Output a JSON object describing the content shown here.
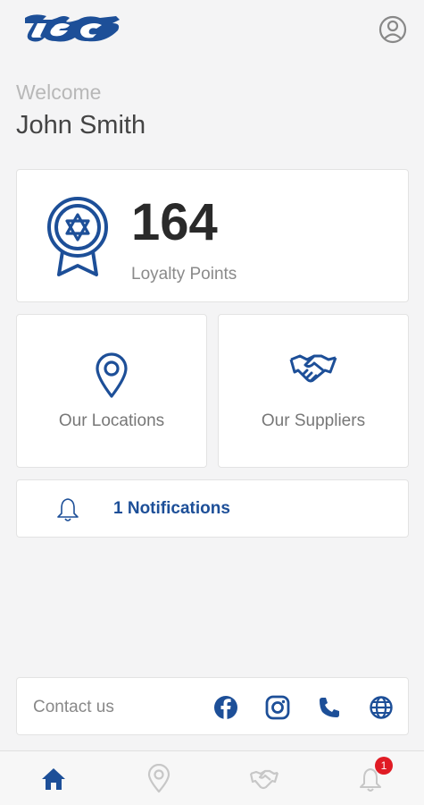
{
  "app": {
    "brand": "tec"
  },
  "header": {
    "profile_icon": "user-circle-icon"
  },
  "greeting": {
    "welcome": "Welcome",
    "user_name": "John Smith"
  },
  "loyalty": {
    "points": "164",
    "label": "Loyalty Points",
    "icon": "award-badge-star-icon"
  },
  "tiles": [
    {
      "label": "Our Locations",
      "icon": "map-pin-icon"
    },
    {
      "label": "Our Suppliers",
      "icon": "handshake-icon"
    }
  ],
  "notifications": {
    "label": "1 Notifications",
    "icon": "bell-icon"
  },
  "contact": {
    "label": "Contact us",
    "icons": [
      "facebook-icon",
      "instagram-icon",
      "phone-icon",
      "globe-icon"
    ]
  },
  "bottom_nav": {
    "items": [
      "home-icon",
      "map-pin-icon",
      "handshake-icon",
      "bell-icon"
    ],
    "active": "home-icon",
    "badge": "1"
  },
  "colors": {
    "accent": "#1d4f98",
    "badge": "#e01b24",
    "inactive": "#c7c7c7"
  }
}
